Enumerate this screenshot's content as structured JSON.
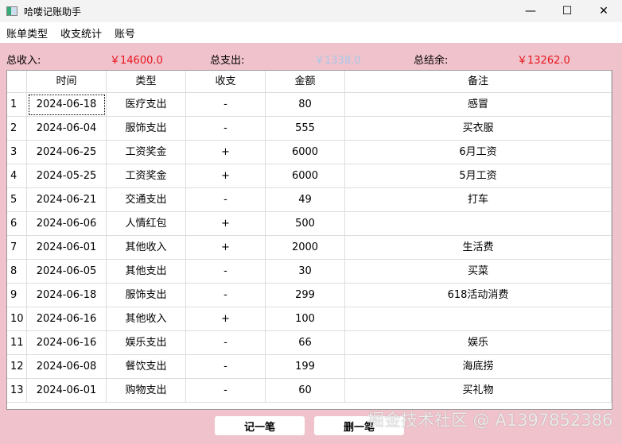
{
  "window": {
    "title": "哈喽记账助手",
    "minimize": "—",
    "maximize": "☐",
    "close": "✕"
  },
  "menu": [
    "账单类型",
    "收支统计",
    "账号"
  ],
  "summary": {
    "income_label": "总收入:",
    "income": "￥14600.0",
    "expense_label": "总支出:",
    "expense": "￥1338.0",
    "balance_label": "总结余:",
    "balance": "￥13262.0",
    "colors": {
      "income": "#e8141e",
      "expense": "#a9c8e8",
      "balance": "#e8141e"
    }
  },
  "table": {
    "headers": [
      "时间",
      "类型",
      "收支",
      "金额",
      "备注"
    ],
    "rows": [
      [
        "1",
        "2024-06-18",
        "医疗支出",
        "-",
        "80",
        "感冒"
      ],
      [
        "2",
        "2024-06-04",
        "服饰支出",
        "-",
        "555",
        "买衣服"
      ],
      [
        "3",
        "2024-06-25",
        "工资奖金",
        "+",
        "6000",
        "6月工资"
      ],
      [
        "4",
        "2024-05-25",
        "工资奖金",
        "+",
        "6000",
        "5月工资"
      ],
      [
        "5",
        "2024-06-21",
        "交通支出",
        "-",
        "49",
        "打车"
      ],
      [
        "6",
        "2024-06-06",
        "人情红包",
        "+",
        "500",
        ""
      ],
      [
        "7",
        "2024-06-01",
        "其他收入",
        "+",
        "2000",
        "生活费"
      ],
      [
        "8",
        "2024-06-05",
        "其他支出",
        "-",
        "30",
        "买菜"
      ],
      [
        "9",
        "2024-06-18",
        "服饰支出",
        "-",
        "299",
        "618活动消费"
      ],
      [
        "10",
        "2024-06-16",
        "其他收入",
        "+",
        "100",
        ""
      ],
      [
        "11",
        "2024-06-16",
        "娱乐支出",
        "-",
        "66",
        "娱乐"
      ],
      [
        "12",
        "2024-06-08",
        "餐饮支出",
        "-",
        "199",
        "海底捞"
      ],
      [
        "13",
        "2024-06-01",
        "购物支出",
        "-",
        "60",
        "买礼物"
      ]
    ]
  },
  "buttons": {
    "add": "记一笔",
    "delete": "删一笔"
  },
  "watermark": "掘金技术社区 @ A1397852386"
}
